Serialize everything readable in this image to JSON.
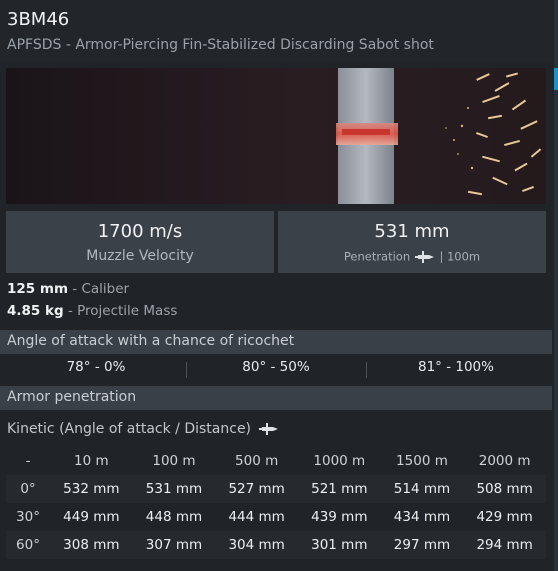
{
  "header": {
    "title": "3BM46",
    "subtitle": "APFSDS - Armor-Piercing Fin-Stabilized Discarding Sabot shot"
  },
  "stats": {
    "velocity_value": "1700 m/s",
    "velocity_label": "Muzzle Velocity",
    "penetration_value": "531 mm",
    "penetration_label": "Penetration",
    "penetration_distance": "| 100m"
  },
  "properties": [
    {
      "value": "125 mm",
      "label": " - Caliber"
    },
    {
      "value": "4.85 kg",
      "label": " - Projectile Mass"
    }
  ],
  "ricochet": {
    "title": "Angle of attack with a chance of ricochet",
    "items": [
      "78° - 0%",
      "80° - 50%",
      "81° - 100%"
    ]
  },
  "penetration": {
    "title": "Armor penetration",
    "kinetic_label": "Kinetic (Angle of attack / Distance)",
    "columns": [
      "-",
      "10 m",
      "100 m",
      "500 m",
      "1000 m",
      "1500 m",
      "2000 m"
    ],
    "rows": [
      {
        "angle": "0°",
        "values": [
          "532 mm",
          "531 mm",
          "527 mm",
          "521 mm",
          "514 mm",
          "508 mm"
        ]
      },
      {
        "angle": "30°",
        "values": [
          "449 mm",
          "448 mm",
          "444 mm",
          "439 mm",
          "434 mm",
          "429 mm"
        ]
      },
      {
        "angle": "60°",
        "values": [
          "308 mm",
          "307 mm",
          "304 mm",
          "301 mm",
          "297 mm",
          "294 mm"
        ]
      }
    ]
  },
  "icons": {
    "shell": "projectile-icon"
  },
  "colors": {
    "background": "#202428",
    "stat_box": "#3b4148",
    "section_bar": "#3a4047",
    "accent": "#1e90c8"
  }
}
